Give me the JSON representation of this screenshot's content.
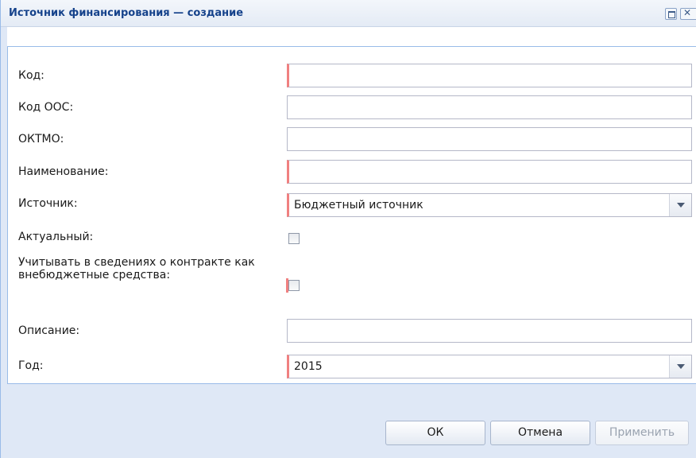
{
  "window": {
    "title": "Источник финансирования — создание"
  },
  "form": {
    "code": {
      "label": "Код:",
      "value": ""
    },
    "oos_code": {
      "label": "Код ООС:",
      "value": ""
    },
    "oktmo": {
      "label": "ОКТМО:",
      "value": ""
    },
    "name": {
      "label": "Наименование:",
      "value": ""
    },
    "source": {
      "label": "Источник:",
      "value": "Бюджетный источник"
    },
    "actual": {
      "label": "Актуальный:",
      "checked": false
    },
    "offbudget": {
      "label": "Учитывать в сведениях о контракте как внебюджетные средства:",
      "checked": false
    },
    "description": {
      "label": "Описание:",
      "value": ""
    },
    "year": {
      "label": "Год:",
      "value": "2015"
    }
  },
  "buttons": {
    "ok": "ОК",
    "cancel": "Отмена",
    "apply": "Применить"
  },
  "colors": {
    "title_text": "#15428b",
    "required_marker": "#f08080",
    "window_frame": "#dfe8f6"
  }
}
